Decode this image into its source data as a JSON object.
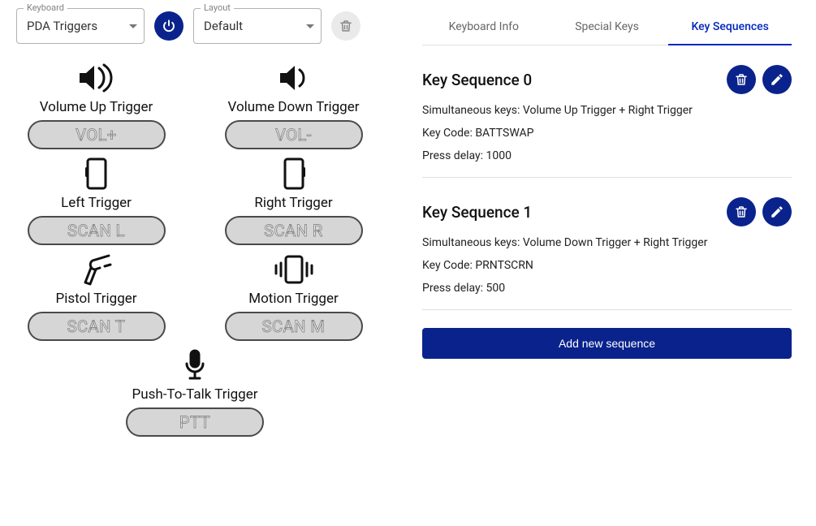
{
  "colors": {
    "accent": "#0a238c"
  },
  "selectors": {
    "keyboard": {
      "label": "Keyboard",
      "value": "PDA Triggers"
    },
    "layout": {
      "label": "Layout",
      "value": "Default"
    }
  },
  "triggers": [
    {
      "label": "Volume Up Trigger",
      "key": "VOL+",
      "icon": "volume-up-icon"
    },
    {
      "label": "Volume Down Trigger",
      "key": "VOL-",
      "icon": "volume-down-icon"
    },
    {
      "label": "Left Trigger",
      "key": "SCAN L",
      "icon": "device-left-icon"
    },
    {
      "label": "Right Trigger",
      "key": "SCAN R",
      "icon": "device-right-icon"
    },
    {
      "label": "Pistol Trigger",
      "key": "SCAN T",
      "icon": "scanner-icon"
    },
    {
      "label": "Motion Trigger",
      "key": "SCAN M",
      "icon": "vibrate-icon"
    },
    {
      "label": "Push-To-Talk Trigger",
      "key": "PTT",
      "icon": "mic-icon"
    }
  ],
  "tabs": {
    "info": "Keyboard Info",
    "special": "Special Keys",
    "sequences": "Key Sequences",
    "active": "sequences"
  },
  "sequences": [
    {
      "title": "Key Sequence 0",
      "simKeysLabel": "Simultaneous keys: ",
      "simKeysValue": "Volume Up Trigger + Right Trigger",
      "codeLabel": "Key Code: ",
      "codeValue": "BATTSWAP",
      "delayLabel": "Press delay: ",
      "delayValue": "1000"
    },
    {
      "title": "Key Sequence 1",
      "simKeysLabel": "Simultaneous keys: ",
      "simKeysValue": "Volume Down Trigger + Right Trigger",
      "codeLabel": "Key Code: ",
      "codeValue": "PRNTSCRN",
      "delayLabel": "Press delay: ",
      "delayValue": "500"
    }
  ],
  "addButton": "Add new sequence"
}
